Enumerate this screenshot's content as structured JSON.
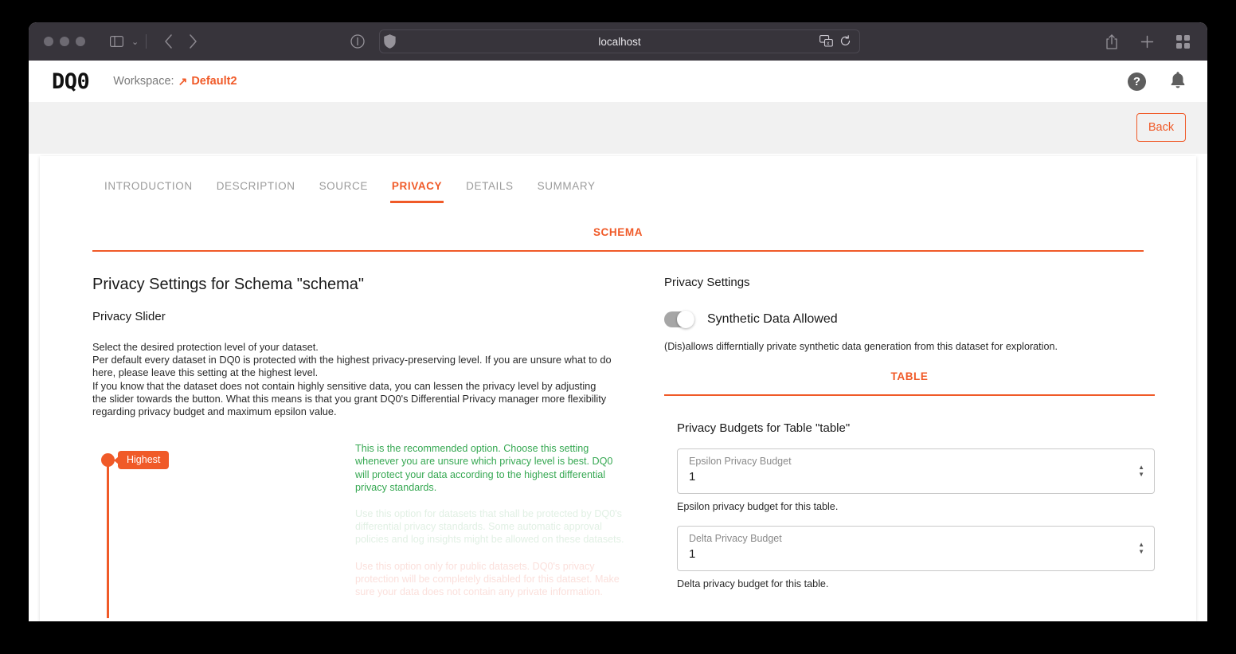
{
  "browser": {
    "url": "localhost",
    "icons": {
      "sidebar": "sidebar-toggle-icon",
      "back": "nav-back-icon",
      "forward": "nav-forward-icon",
      "reader": "reader-view-icon",
      "shield": "privacy-shield-icon",
      "translate": "translate-icon",
      "reload": "reload-icon",
      "share": "share-icon",
      "newtab": "new-tab-icon",
      "taboverview": "tab-overview-icon"
    }
  },
  "app": {
    "logo": "DQ0",
    "workspace_label": "Workspace:",
    "workspace_arrow": "↗",
    "workspace_value": "Default2",
    "help_icon_glyph": "?",
    "bell_icon": "notification-bell-icon",
    "back_button": "Back"
  },
  "tabs": [
    {
      "label": "INTRODUCTION",
      "active": false
    },
    {
      "label": "DESCRIPTION",
      "active": false
    },
    {
      "label": "SOURCE",
      "active": false
    },
    {
      "label": "PRIVACY",
      "active": true
    },
    {
      "label": "DETAILS",
      "active": false
    },
    {
      "label": "SUMMARY",
      "active": false
    }
  ],
  "schema_tab": "SCHEMA",
  "left": {
    "page_title": "Privacy Settings for Schema \"schema\"",
    "slider_heading": "Privacy Slider",
    "intro_line1": "Select the desired protection level of your dataset.",
    "intro_line2": "Per default every dataset in DQ0 is protected with the highest privacy-preserving level. If you are unsure what to do here, please leave this setting at the highest level.",
    "intro_line3": "If you know that the dataset does not contain highly sensitive data, you can lessen the privacy level by adjusting the slider towards the button. What this means is that you grant DQ0's Differential Privacy manager more flexibility regarding privacy budget and maximum epsilon value.",
    "slider_value_label": "Highest",
    "descriptions": [
      "This is the recommended option. Choose this setting whenever you are unsure which privacy level is best. DQ0 will protect your data according to the highest differential privacy standards.",
      "Use this option for datasets that shall be protected by DQ0's differential privacy standards. Some automatic approval policies and log insights might be allowed on these datasets.",
      "Use this option only for public datasets. DQ0's privacy protection will be completely disabled for this dataset. Make sure your data does not contain any private information."
    ]
  },
  "right": {
    "heading": "Privacy Settings",
    "toggle_label": "Synthetic Data Allowed",
    "toggle_state": "off",
    "toggle_helper": "(Dis)allows differntially private synthetic data generation from this dataset for exploration.",
    "table_tab": "TABLE",
    "budget_title": "Privacy Budgets for Table \"table\"",
    "fields": [
      {
        "label": "Epsilon Privacy Budget",
        "value": "1",
        "help": "Epsilon privacy budget for this table."
      },
      {
        "label": "Delta Privacy Budget",
        "value": "1",
        "help": "Delta privacy budget for this table."
      }
    ]
  },
  "colors": {
    "accent": "#f05a28",
    "green": "#36a852",
    "chrome": "#37343b",
    "strip": "#f1f1f1"
  }
}
